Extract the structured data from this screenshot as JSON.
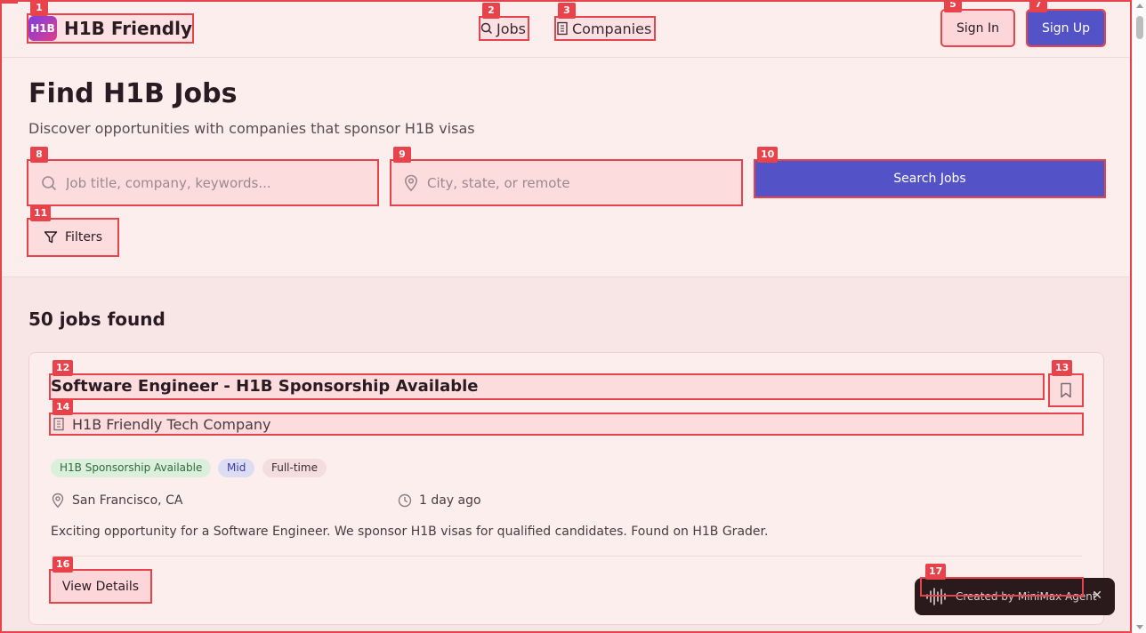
{
  "header": {
    "logo_mark": "H1B",
    "logo_text": "H1B Friendly",
    "nav": [
      {
        "label": "Jobs",
        "icon": "search-icon"
      },
      {
        "label": "Companies",
        "icon": "building-icon"
      }
    ],
    "sign_in": "Sign In",
    "sign_up": "Sign Up"
  },
  "hero": {
    "title": "Find H1B Jobs",
    "subtitle": "Discover opportunities with companies that sponsor H1B visas",
    "keyword_placeholder": "Job title, company, keywords...",
    "location_placeholder": "City, state, or remote",
    "search_button": "Search Jobs",
    "filters_button": "Filters"
  },
  "results": {
    "count_text": "50 jobs found",
    "jobs": [
      {
        "title": "Software Engineer - H1B Sponsorship Available",
        "company": "H1B Friendly Tech Company",
        "tags": [
          "H1B Sponsorship Available",
          "Mid",
          "Full-time"
        ],
        "location": "San Francisco, CA",
        "posted": "1 day ago",
        "description": "Exciting opportunity for a Software Engineer. We sponsor H1B visas for qualified candidates. Found on H1B Grader.",
        "details_button": "View Details"
      }
    ]
  },
  "toast": {
    "text": "Created by MiniMax Agent",
    "close": "✕"
  },
  "annotations": [
    "1",
    "2",
    "3",
    "5",
    "7",
    "8",
    "9",
    "10",
    "11",
    "12",
    "13",
    "14",
    "16",
    "17"
  ],
  "colors": {
    "accent": "#5352c6",
    "annotation": "#e8434b",
    "background": "#fdeeee"
  }
}
